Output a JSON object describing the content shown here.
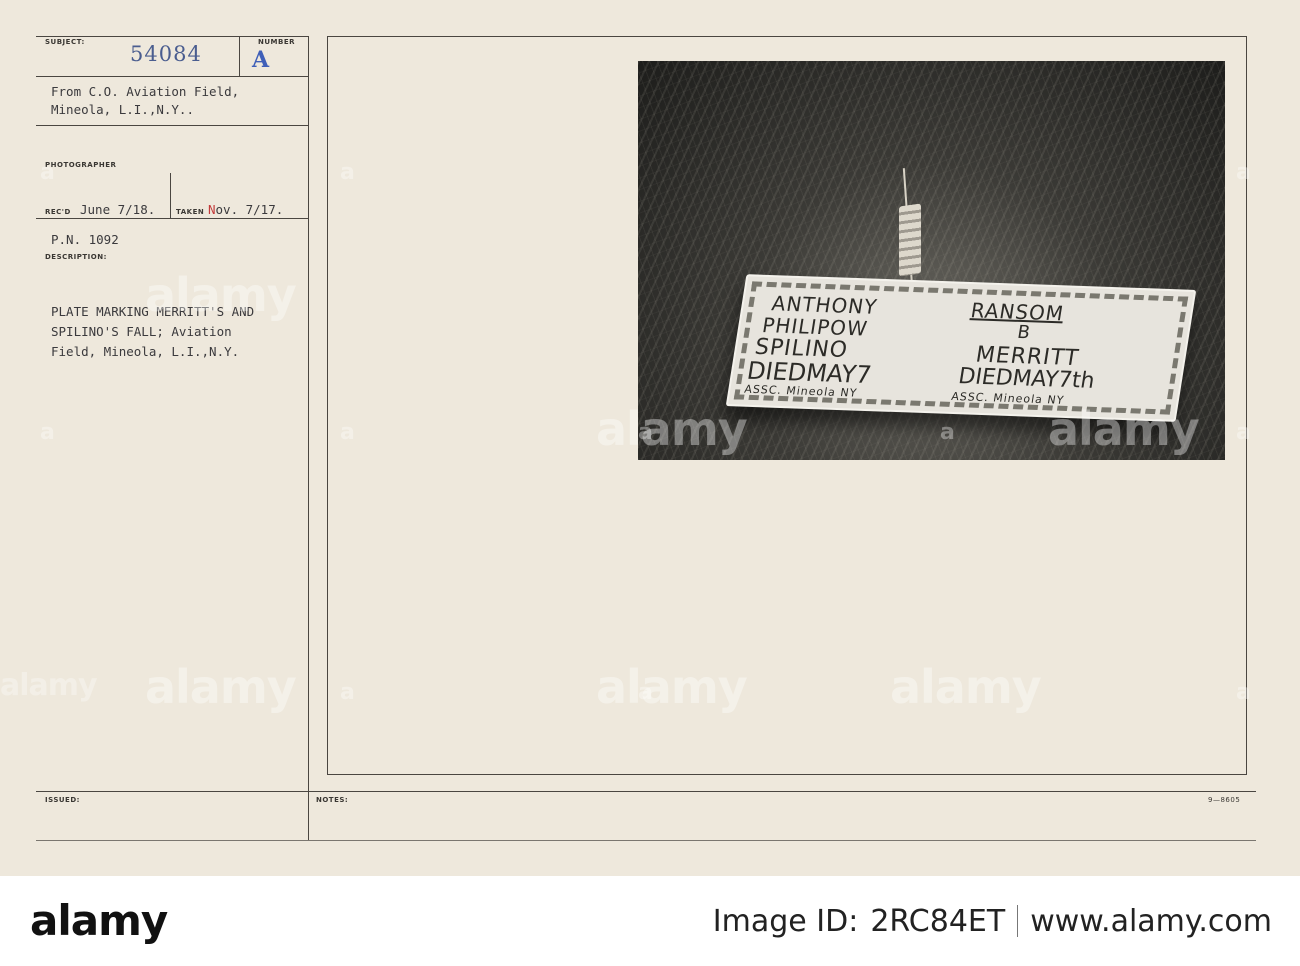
{
  "form": {
    "subject_label": "SUBJECT:",
    "subject_number": "54084",
    "number_label": "NUMBER",
    "number_value": "A",
    "from_line1": "From C.O. Aviation Field,",
    "from_line2": "Mineola, L.I.,N.Y..",
    "photographer_label": "PHOTOGRAPHER",
    "recd_label": "REC'D",
    "recd_date": "June 7/18.",
    "taken_label": "TAKEN",
    "taken_date_month": "N",
    "taken_date_rest": "ov. 7/17.",
    "pn": "P.N. 1092",
    "description_label": "DESCRIPTION:",
    "desc_line1": "PLATE MARKING MERRITT'S AND",
    "desc_line2": "SPILINO'S FALL; Aviation",
    "desc_line3": "Field, Mineola, L.I.,N.Y.",
    "issued_label": "ISSUED:",
    "notes_label": "NOTES:",
    "form_code": "9—8605"
  },
  "plate": {
    "left_line1": "ANTHONY",
    "left_line2": "PHILIPOW",
    "left_line3": "SPILINO",
    "left_line4": "DIEDMAY7",
    "left_line5": "ASSC. Mineola NY",
    "right_line1": "RANSOM",
    "right_line2": "B",
    "right_line3": "MERRITT",
    "right_line4": "DIEDMAY7th",
    "right_line5": "ASSC. Mineola NY"
  },
  "watermark": {
    "text": "alamy",
    "small": "a"
  },
  "stock_bar": {
    "logo": "alamy",
    "image_id_label": "Image ID:",
    "image_id": "2RC84ET",
    "site": "www.alamy.com"
  }
}
